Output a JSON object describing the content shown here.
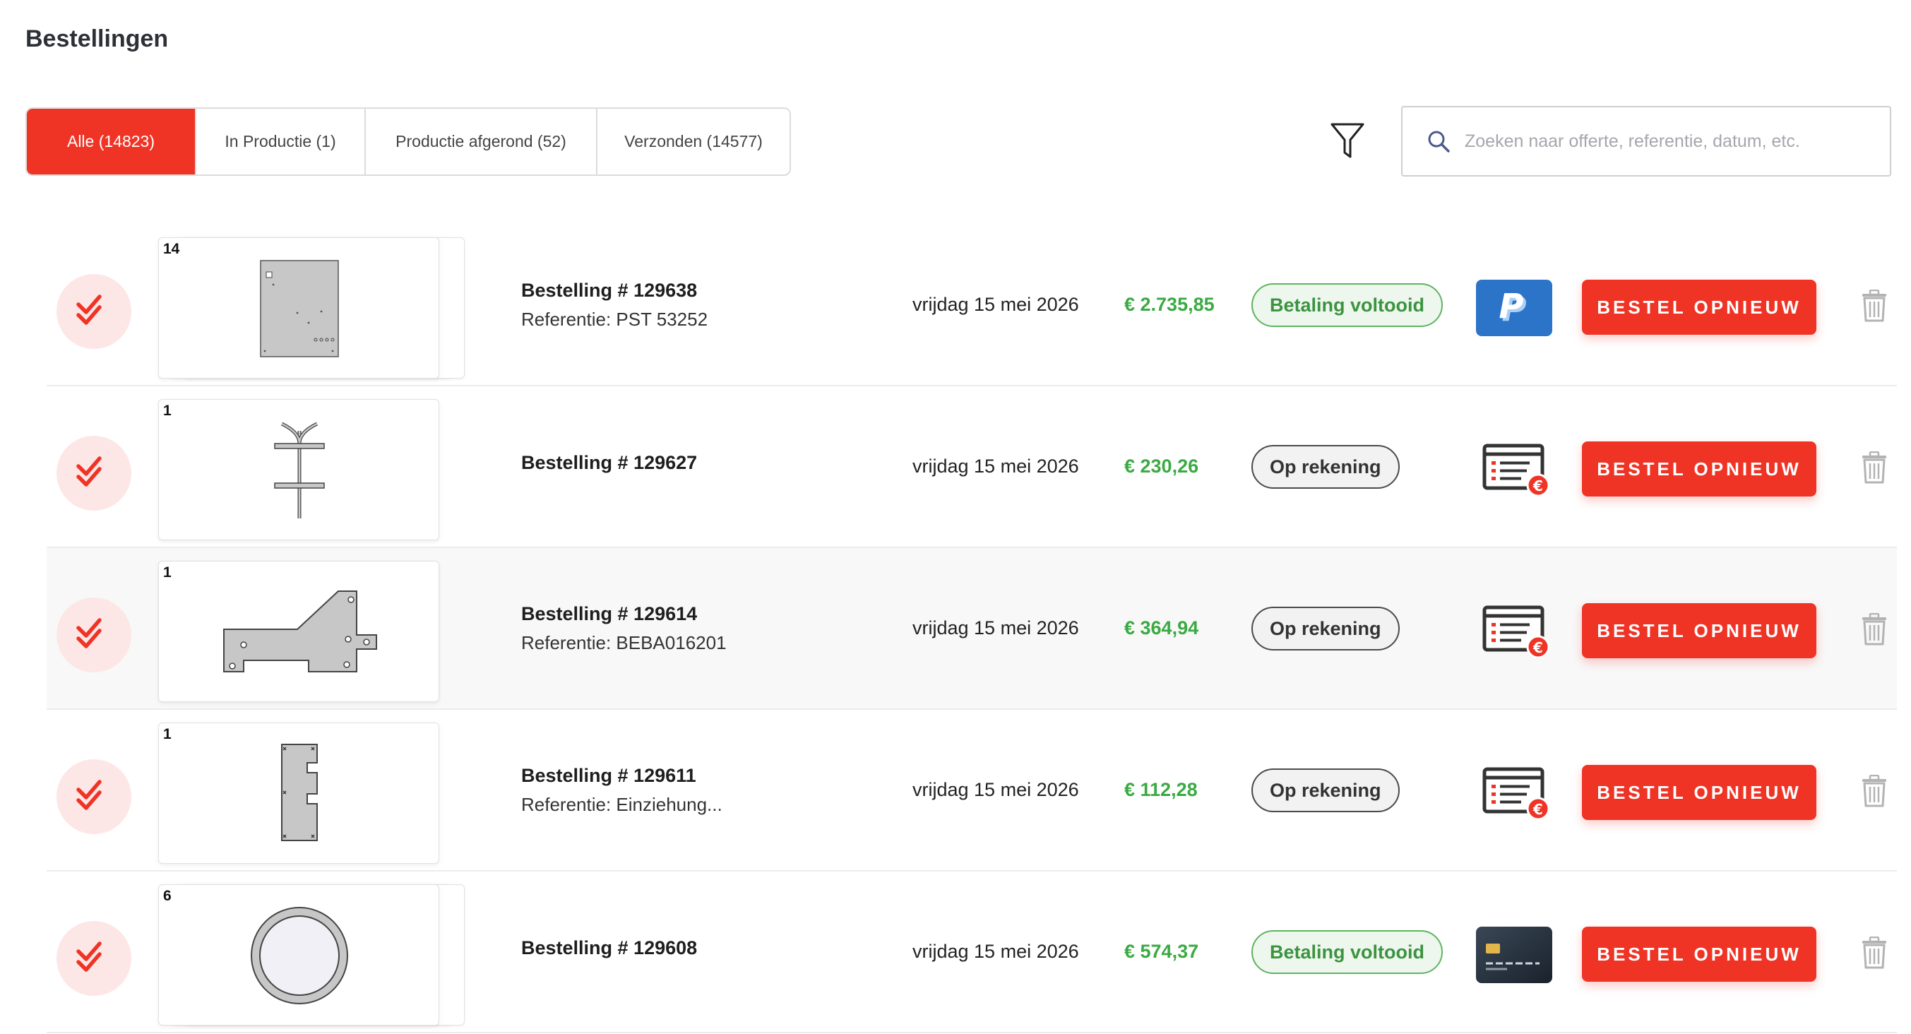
{
  "page_title": "Bestellingen",
  "tabs": [
    {
      "label": "Alle (14823)",
      "active": true
    },
    {
      "label": "In Productie (1)",
      "active": false
    },
    {
      "label": "Productie afgerond (52)",
      "active": false
    },
    {
      "label": "Verzonden (14577)",
      "active": false
    }
  ],
  "search": {
    "placeholder": "Zoeken naar offerte, referentie, datum, etc.",
    "value": ""
  },
  "icons": {
    "filter": "filter-icon",
    "search": "search-icon",
    "status": "double-check-icon",
    "delete": "trash-icon"
  },
  "colors": {
    "accent": "#ef3426",
    "price": "#3aaa42",
    "paid_status": "#3c9340",
    "check_bg": "#fde7e6"
  },
  "orders": [
    {
      "quantity": "14",
      "part_shape": "perforated-plate",
      "stacked": true,
      "order_number": "Bestelling # 129638",
      "reference": "Referentie: PST 53252",
      "date": "vrijdag 15 mei 2026",
      "price": "€ 2.735,85",
      "status": "Betaling voltooid",
      "status_type": "paid",
      "payment_method": "paypal-icon",
      "reorder_label": "BESTEL OPNIEUW"
    },
    {
      "quantity": "1",
      "part_shape": "y-bracket",
      "stacked": false,
      "order_number": "Bestelling # 129627",
      "reference": "",
      "date": "vrijdag 15 mei 2026",
      "price": "€ 230,26",
      "status": "Op rekening",
      "status_type": "invoice",
      "payment_method": "invoice-icon",
      "reorder_label": "BESTEL OPNIEUW"
    },
    {
      "quantity": "1",
      "part_shape": "angled-plate",
      "stacked": false,
      "order_number": "Bestelling # 129614",
      "reference": "Referentie: BEBA016201",
      "date": "vrijdag 15 mei 2026",
      "price": "€ 364,94",
      "status": "Op rekening",
      "status_type": "invoice",
      "payment_method": "invoice-icon",
      "reorder_label": "BESTEL OPNIEUW"
    },
    {
      "quantity": "1",
      "part_shape": "notched-strip",
      "stacked": false,
      "order_number": "Bestelling # 129611",
      "reference": "Referentie: Einziehung...",
      "date": "vrijdag 15 mei 2026",
      "price": "€ 112,28",
      "status": "Op rekening",
      "status_type": "invoice",
      "payment_method": "invoice-icon",
      "reorder_label": "BESTEL OPNIEUW"
    },
    {
      "quantity": "6",
      "part_shape": "ring",
      "stacked": true,
      "order_number": "Bestelling # 129608",
      "reference": "",
      "date": "vrijdag 15 mei 2026",
      "price": "€ 574,37",
      "status": "Betaling voltooid",
      "status_type": "paid",
      "payment_method": "credit-card-icon",
      "reorder_label": "BESTEL OPNIEUW"
    }
  ]
}
